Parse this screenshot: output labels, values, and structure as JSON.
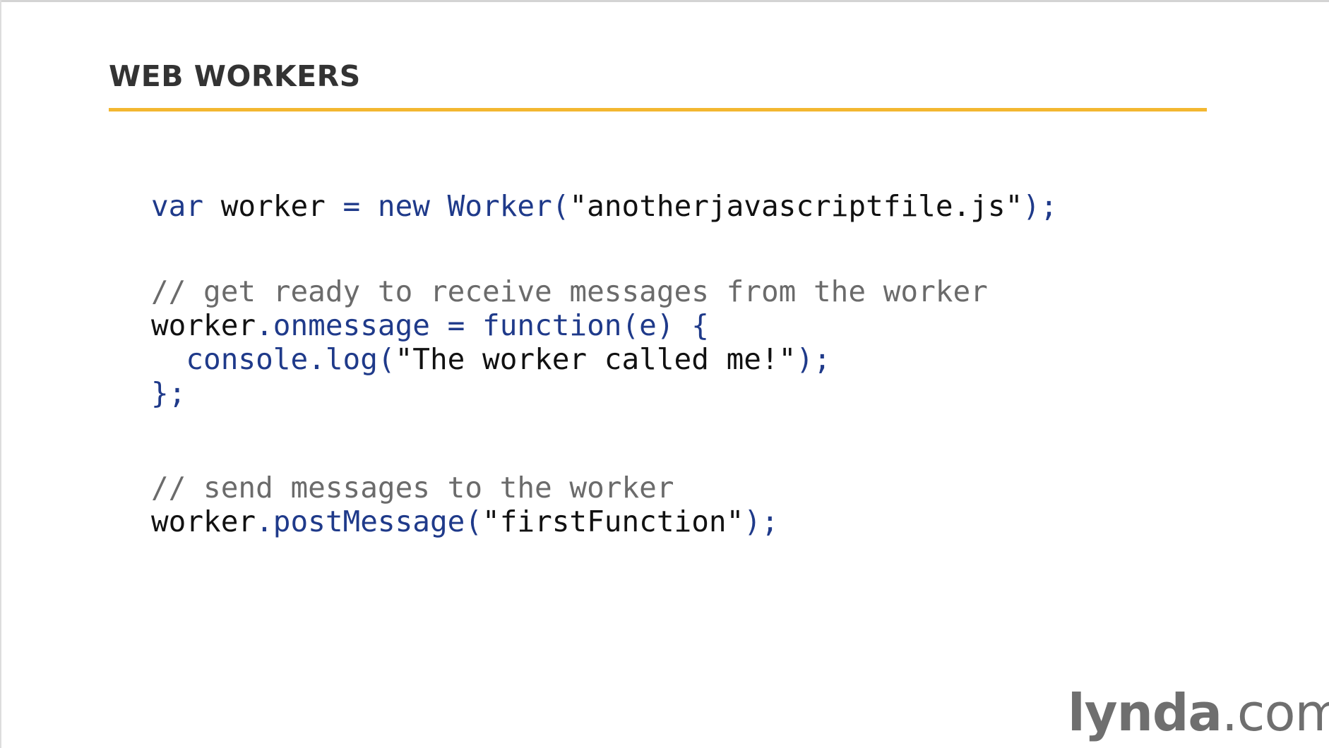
{
  "slide": {
    "title": "WEB WORKERS",
    "accent_color": "#f3b731"
  },
  "code": {
    "line1": {
      "kw_var": "var",
      "ident_worker": " worker",
      "op_eq": " = ",
      "kw_new": "new",
      "ctor": " Worker(",
      "str": "\"anotherjavascriptfile.js\"",
      "end": ");"
    },
    "line2": {
      "comment": "// get ready to receive messages from the worker"
    },
    "line3": {
      "ident_worker": "worker",
      "prop": ".onmessage",
      "op_eq": " = ",
      "fn": "function(e) {"
    },
    "line4": {
      "indent": "  ",
      "call": "console.log(",
      "str": "\"The worker called me!\"",
      "end": ");"
    },
    "line5": {
      "close": "};"
    },
    "line6": {
      "comment": "// send messages to the worker"
    },
    "line7": {
      "ident_worker": "worker",
      "call": ".postMessage(",
      "str": "\"firstFunction\"",
      "end": ");"
    }
  },
  "branding": {
    "logo_main": "lynda",
    "logo_suffix": ".com"
  }
}
